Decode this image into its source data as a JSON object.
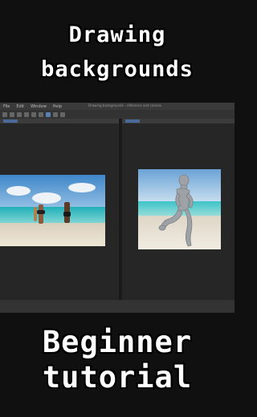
{
  "overlay": {
    "top_line1": "Drawing",
    "top_line2": "backgrounds",
    "bottom_line1": "Beginner",
    "bottom_line2": "tutorial"
  },
  "app": {
    "menu": [
      "File",
      "Edit",
      "Window",
      "Help"
    ],
    "window_title": "Drawing backgrounds - reference and canvas"
  },
  "icons": {
    "reference_photo": "beach-photo-icon",
    "canvas_figure": "3d-mannequin-icon"
  },
  "colors": {
    "ui_bg": "#2b2b2b",
    "accent": "#5a7fb5"
  }
}
